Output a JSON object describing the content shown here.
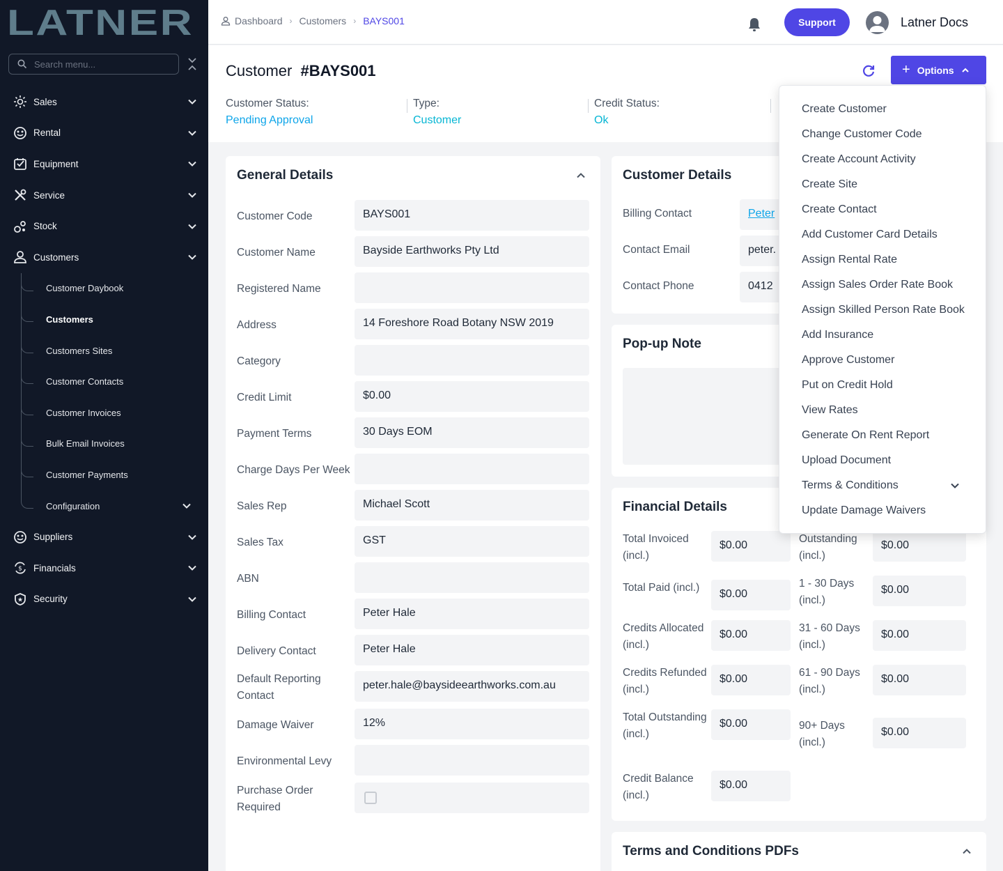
{
  "brand": {
    "logo_text": "LATNER",
    "accent": "#4f46e5",
    "sidebar_bg": "#111827"
  },
  "sidebar": {
    "search_placeholder": "Search menu...",
    "items": [
      {
        "label": "Sales",
        "icon": "sales-icon"
      },
      {
        "label": "Rental",
        "icon": "rental-icon"
      },
      {
        "label": "Equipment",
        "icon": "equipment-icon"
      },
      {
        "label": "Service",
        "icon": "service-icon"
      },
      {
        "label": "Stock",
        "icon": "stock-icon"
      },
      {
        "label": "Customers",
        "icon": "user-icon"
      }
    ],
    "customers_sub": [
      {
        "label": "Customer Daybook"
      },
      {
        "label": "Customers",
        "active": true
      },
      {
        "label": "Customers Sites"
      },
      {
        "label": "Customer Contacts"
      },
      {
        "label": "Customer Invoices"
      },
      {
        "label": "Bulk Email Invoices"
      },
      {
        "label": "Customer Payments"
      },
      {
        "label": "Configuration"
      }
    ],
    "items_after": [
      {
        "label": "Suppliers",
        "icon": "suppliers-icon"
      },
      {
        "label": "Financials",
        "icon": "financials-icon"
      },
      {
        "label": "Security",
        "icon": "shield-icon"
      }
    ]
  },
  "topbar": {
    "breadcrumb": [
      "Dashboard",
      "Customers",
      "BAYS001"
    ],
    "support_label": "Support",
    "user_name": "Latner Docs"
  },
  "header": {
    "title_prefix": "Customer",
    "title_code": "#BAYS001",
    "options_label": "Options",
    "status": [
      {
        "label": "Customer Status:",
        "value": "Pending Approval"
      },
      {
        "label": "Type:",
        "value": "Customer"
      },
      {
        "label": "Credit Status:",
        "value": "Ok"
      }
    ]
  },
  "general": {
    "title": "General Details",
    "fields": [
      {
        "label": "Customer Code",
        "value": "BAYS001"
      },
      {
        "label": "Customer Name",
        "value": "Bayside Earthworks Pty Ltd"
      },
      {
        "label": "Registered Name",
        "value": ""
      },
      {
        "label": "Address",
        "value": "14 Foreshore Road Botany NSW 2019"
      },
      {
        "label": "Category",
        "value": ""
      },
      {
        "label": "Credit Limit",
        "value": "$0.00"
      },
      {
        "label": "Payment Terms",
        "value": "30 Days EOM"
      },
      {
        "label": "Charge Days Per Week",
        "value": ""
      },
      {
        "label": "Sales Rep",
        "value": "Michael Scott"
      },
      {
        "label": "Sales Tax",
        "value": "GST"
      },
      {
        "label": "ABN",
        "value": ""
      },
      {
        "label": "Billing Contact",
        "value": "Peter Hale"
      },
      {
        "label": "Delivery Contact",
        "value": "Peter Hale"
      },
      {
        "label": "Default Reporting Contact",
        "value": "peter.hale@baysideearthworks.com.au"
      },
      {
        "label": "Damage Waiver",
        "value": "12%"
      },
      {
        "label": "Environmental Levy",
        "value": ""
      },
      {
        "label": "Purchase Order Required",
        "value": ""
      }
    ]
  },
  "customer_details": {
    "title": "Customer Details",
    "fields": [
      {
        "label": "Billing Contact",
        "value": "Peter"
      },
      {
        "label": "Contact Email",
        "value": "peter."
      },
      {
        "label": "Contact Phone",
        "value": "0412"
      }
    ]
  },
  "popup_note": {
    "title": "Pop-up Note"
  },
  "financial": {
    "title": "Financial Details",
    "left": [
      {
        "label": "Total Invoiced (incl.)",
        "value": "$0.00"
      },
      {
        "label": "Total Paid (incl.)",
        "value": "$0.00"
      },
      {
        "label": "Credits Allocated (incl.)",
        "value": "$0.00"
      },
      {
        "label": "Credits Refunded (incl.)",
        "value": "$0.00"
      },
      {
        "label": "Total Outstanding (incl.)",
        "value": "$0.00"
      },
      {
        "label": "Credit Balance (incl.)",
        "value": "$0.00"
      }
    ],
    "right": [
      {
        "label": "Outstanding (incl.)",
        "value": "$0.00"
      },
      {
        "label": "1 - 30 Days (incl.)",
        "value": "$0.00"
      },
      {
        "label": "31 - 60 Days (incl.)",
        "value": "$0.00"
      },
      {
        "label": "61 - 90 Days (incl.)",
        "value": "$0.00"
      },
      {
        "label": "90+ Days (incl.)",
        "value": "$0.00"
      }
    ]
  },
  "terms": {
    "title": "Terms and Conditions PDFs"
  },
  "options_menu": [
    "Create Customer",
    "Change Customer Code",
    "Create Account Activity",
    "Create Site",
    "Create Contact",
    "Add Customer Card Details",
    "Assign Rental Rate",
    "Assign Sales Order Rate Book",
    "Assign Skilled Person Rate Book",
    "Add Insurance",
    "Approve Customer",
    "Put on Credit Hold",
    "View Rates",
    "Generate On Rent Report",
    "Upload Document",
    "Terms & Conditions",
    "Update Damage Waivers"
  ]
}
